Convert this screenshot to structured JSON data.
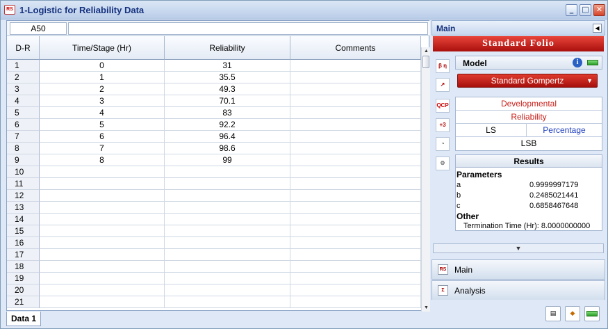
{
  "window": {
    "title": "1-Logistic for Reliability Data",
    "icon": "reliasoft-app-icon",
    "controls": [
      "minimize",
      "maximize",
      "close"
    ]
  },
  "sheet": {
    "cell_ref": "A50",
    "formula": "",
    "columns": [
      "D-R",
      "Time/Stage (Hr)",
      "Reliability",
      "Comments"
    ],
    "rows": [
      {
        "n": "1",
        "t": "0",
        "r": "31",
        "c": ""
      },
      {
        "n": "2",
        "t": "1",
        "r": "35.5",
        "c": ""
      },
      {
        "n": "3",
        "t": "2",
        "r": "49.3",
        "c": ""
      },
      {
        "n": "4",
        "t": "3",
        "r": "70.1",
        "c": ""
      },
      {
        "n": "5",
        "t": "4",
        "r": "83",
        "c": ""
      },
      {
        "n": "6",
        "t": "5",
        "r": "92.2",
        "c": ""
      },
      {
        "n": "7",
        "t": "6",
        "r": "96.4",
        "c": ""
      },
      {
        "n": "8",
        "t": "7",
        "r": "98.6",
        "c": ""
      },
      {
        "n": "9",
        "t": "8",
        "r": "99",
        "c": ""
      },
      {
        "n": "10",
        "t": "",
        "r": "",
        "c": ""
      },
      {
        "n": "11",
        "t": "",
        "r": "",
        "c": ""
      },
      {
        "n": "12",
        "t": "",
        "r": "",
        "c": ""
      },
      {
        "n": "13",
        "t": "",
        "r": "",
        "c": ""
      },
      {
        "n": "14",
        "t": "",
        "r": "",
        "c": ""
      },
      {
        "n": "15",
        "t": "",
        "r": "",
        "c": ""
      },
      {
        "n": "16",
        "t": "",
        "r": "",
        "c": ""
      },
      {
        "n": "17",
        "t": "",
        "r": "",
        "c": ""
      },
      {
        "n": "18",
        "t": "",
        "r": "",
        "c": ""
      },
      {
        "n": "19",
        "t": "",
        "r": "",
        "c": ""
      },
      {
        "n": "20",
        "t": "",
        "r": "",
        "c": ""
      },
      {
        "n": "21",
        "t": "",
        "r": "",
        "c": ""
      }
    ],
    "tabs": [
      "Data 1"
    ]
  },
  "panel": {
    "header": "Main",
    "banner": "Standard Folio",
    "model_label": "Model",
    "model_value": "Standard Gompertz",
    "option_developmental": "Developmental",
    "option_reliability": "Reliability",
    "option_ls": "LS",
    "option_percentage": "Percentage",
    "option_lsb": "LSB",
    "results_title": "Results",
    "parameters_label": "Parameters",
    "params": [
      {
        "name": "a",
        "value": "0.9999997179"
      },
      {
        "name": "b",
        "value": "0.2485021441"
      },
      {
        "name": "c",
        "value": "0.6858467648"
      }
    ],
    "other_label": "Other",
    "termination": "Termination Time (Hr): 8.0000000000",
    "nav_main": "Main",
    "nav_analysis": "Analysis"
  },
  "colors": {
    "accent_red": "#c0150f",
    "link_blue": "#1f3fbf",
    "dev_red": "#c8201a"
  }
}
